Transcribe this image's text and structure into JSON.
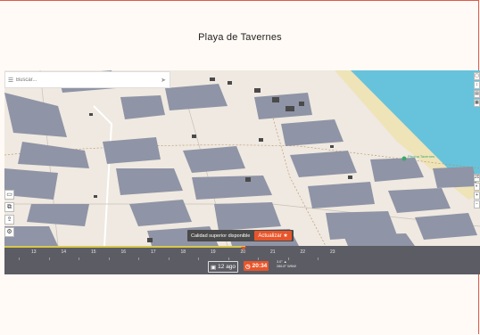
{
  "page": {
    "title": "Playa de Tavernes"
  },
  "search": {
    "placeholder": "Buscar..."
  },
  "map": {
    "poi_label": "Piscina Tavernes",
    "water_color": "#67c3dc",
    "beach_color": "#efe3b8",
    "land_color": "#efe9e1",
    "shadow_color": "#8f94a6"
  },
  "left_tools": [
    "folder-icon",
    "layers-icon",
    "share-icon",
    "settings-icon"
  ],
  "right_tools": [
    "draw-icon",
    "ruler-icon",
    "calendar-icon",
    "grid-icon"
  ],
  "right_controls": {
    "zoom_label": "20",
    "extra_labels": [
      "+",
      "−"
    ]
  },
  "banner": {
    "text": "Calidad superior disponible",
    "button": "Actualizar ★"
  },
  "timeline": {
    "hours": [
      "13",
      "14",
      "15",
      "16",
      "17",
      "18",
      "19",
      "20",
      "21",
      "22",
      "23"
    ],
    "progress_percent": 50
  },
  "date": {
    "label": "12 ago",
    "icon": "calendar-icon"
  },
  "time": {
    "label": "20:34",
    "icon": "clock-icon"
  },
  "sun": {
    "elevation": "3.0° ▲",
    "azimuth": "286.8° WNW"
  },
  "colors": {
    "accent": "#e8552b",
    "timebar": "#5c5c64",
    "progress": "#d8c84a"
  }
}
